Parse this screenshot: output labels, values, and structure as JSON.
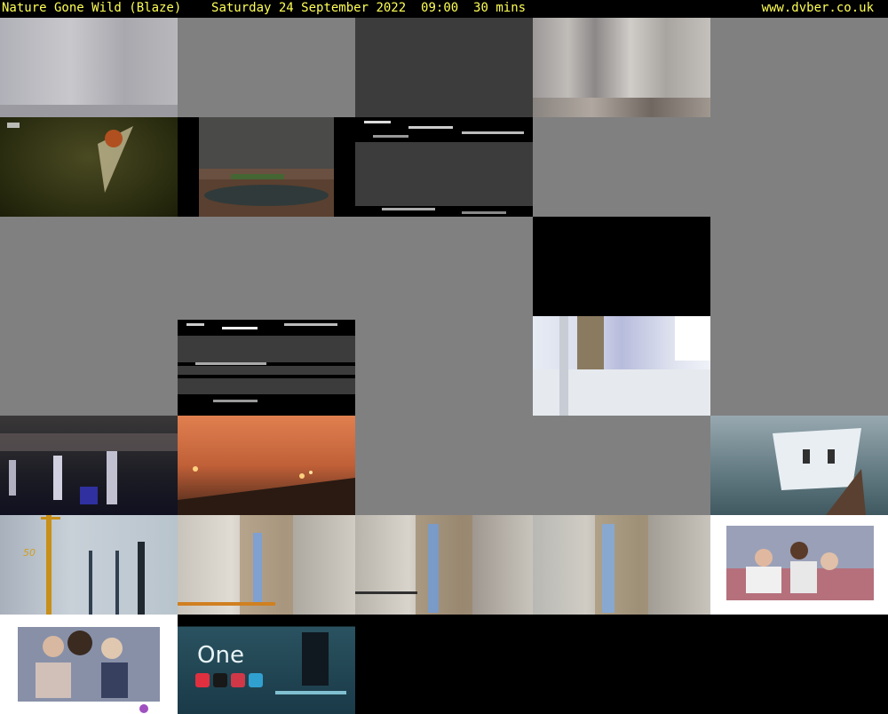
{
  "header": {
    "title": "Nature Gone Wild (Blaze)",
    "date": "Saturday 24 September 2022",
    "time": "09:00",
    "duration": "30 mins",
    "site": "www.dvber.co.uk"
  },
  "thumbs": {
    "overlay_one": "One",
    "overlay_fifty": "50"
  },
  "colors": {
    "header_text": "#ffff55",
    "background": "#000000",
    "empty_tile": "#808080"
  }
}
